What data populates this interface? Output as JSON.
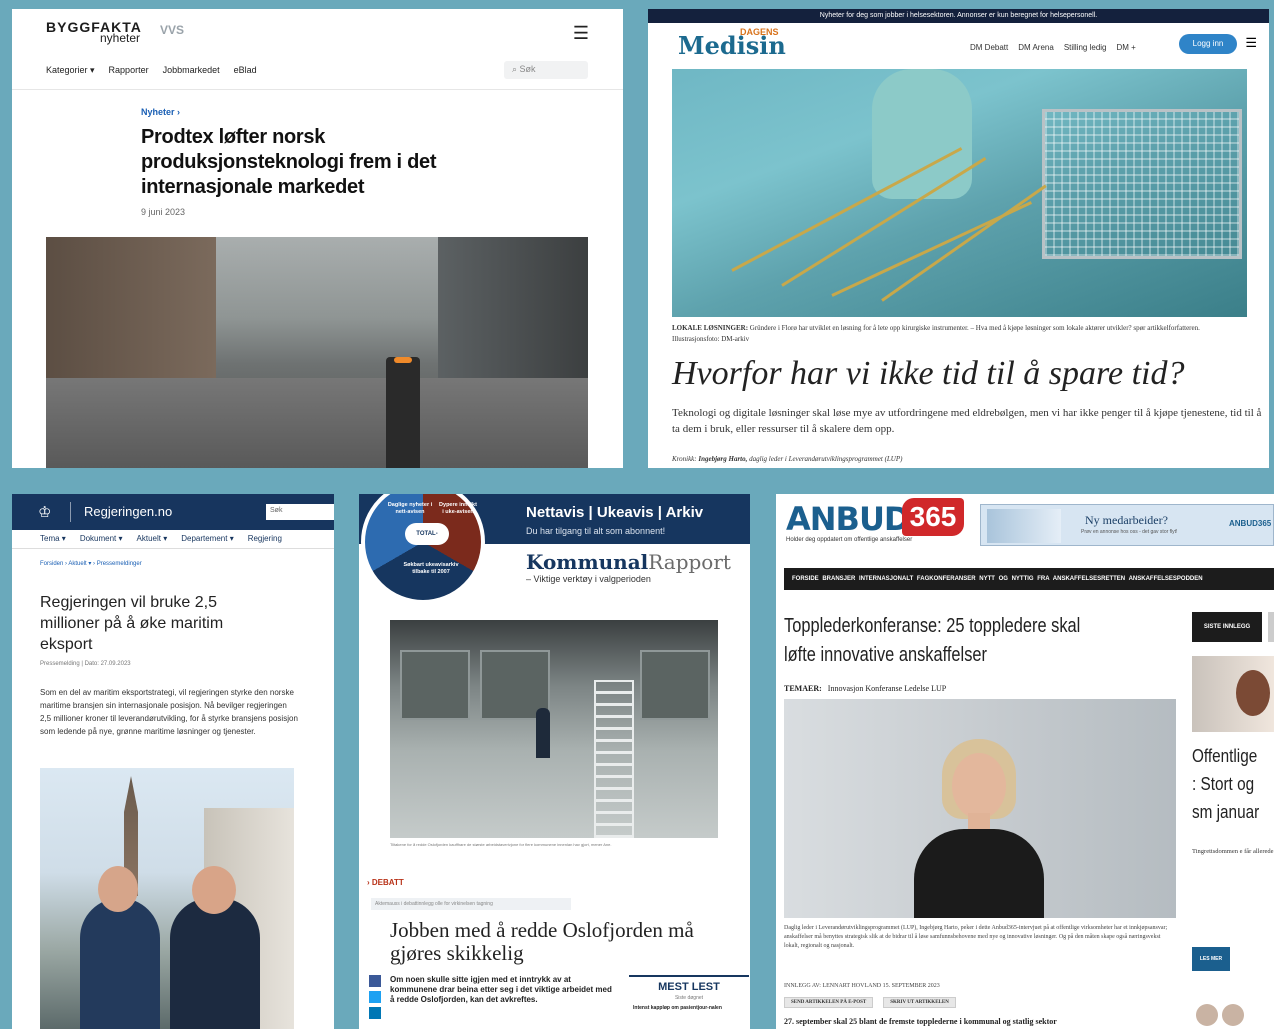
{
  "byggfakta": {
    "logo": "BYGGFAKTA",
    "logo_sub": "nyheter",
    "logo_partner": "VVS",
    "nav": [
      "Kategorier ▾",
      "Rapporter",
      "Jobbmarkedet",
      "eBlad"
    ],
    "search_placeholder": "Søk",
    "kicker": "Nyheter ›",
    "headline": "Prodtex løfter norsk produksjonsteknologi frem i det internasjonale markedet",
    "date": "9 juni 2023"
  },
  "medisin": {
    "topbar": "Nyheter for deg som jobber i helsesektoren. Annonser er kun beregnet for helsepersonell.",
    "logo_small": "DAGENS",
    "logo": "Medisin",
    "nav": [
      "DM Debatt",
      "DM Arena",
      "Stilling ledig",
      "DM +"
    ],
    "login": "Logg inn",
    "caption_label": "LOKALE LØSNINGER:",
    "caption": "Gründere i Florø har utviklet en løsning for å lete opp kirurgiske instrumenter. – Hva med å kjøpe løsninger som lokale aktører utvikler? spør artikkelforfatteren. Illustrasjonsfoto: DM-arkiv",
    "headline": "Hvorfor har vi ikke tid til å spare tid?",
    "lead": "Teknologi og digitale løsninger skal løse mye av utfordringene med eldrebølgen, men vi har ikke penger til å kjøpe tjenestene, tid til å ta dem i bruk, eller ressurser til å skalere dem opp.",
    "byline_label": "Kronikk:",
    "byline_name": "Ingebjørg Harto,",
    "byline_role": "daglig leder i Leverandørutviklingsprogrammet (LUP)"
  },
  "regjeringen": {
    "crest": "♔",
    "site": "Regjeringen.no",
    "search": "Søk",
    "nav": [
      "Tema ▾",
      "Dokument ▾",
      "Aktuelt ▾",
      "Departement ▾",
      "Regjering"
    ],
    "breadcrumb": "Forsiden › Aktuelt ▾ › Pressemeldinger",
    "headline": "Regjeringen vil bruke 2,5 millioner på å øke maritim eksport",
    "meta": "Pressemelding | Dato: 27.09.2023",
    "body": "Som en del av maritim eksportstrategi, vil regjeringen styrke den norske maritime bransjen sin internasjonale posisjon. Nå bevilger regjeringen 2,5 millioner kroner til leverandørutvikling, for å styrke bransjens posisjon som ledende på nye, grønne maritime løsninger og tjenester."
  },
  "kommunal": {
    "pie_t1": "Daglige nyheter i nett-avisen",
    "pie_t2": "Dypere innsikt i uke-avisen",
    "pie_center": "TOTAL-",
    "pie_t3": "Søkbart ukeavisarkiv tilbake til 2007",
    "nav": "Nettavis | Ukeavis | Arkiv",
    "nav_sub": "Du har tilgang til alt som abonnent!",
    "brand_bold": "Kommunal",
    "brand_light": "Rapport",
    "tagline": "– Viktige verktøy i valgperioden",
    "photo_caption": "Tiltakene for å redde Oslofjorden kauffhare de største arbeidstaverivjone for flere kommunene innenlan hav gjort, mener Ane.",
    "section": "› DEBATT",
    "intro": "Aktemauss i debattinnlegg olle for virkinelsen tagning",
    "headline": "Jobben med å redde Oslofjorden må gjøres skikkelig",
    "text": "Om noen skulle sitte igjen med et inntrykk av at kommunene drar beina etter seg i det viktige arbeidet med å redde Oslofjorden, kan det avkreftes.",
    "mest": "MEST LEST",
    "mest_sub": "Siste døgnet",
    "mest_item": "Intenst kappløp om pasientjour-nalen"
  },
  "anbud": {
    "logo": "ANBUD",
    "logo_num": "365",
    "logo_sub": "Holder deg oppdatert om offentlige anskaffelser",
    "ad_title": "Ny medarbeider?",
    "ad_sub": "Prøv en annonse hos oss - det gav stor flyt!",
    "ad_brand": "ANBUD365",
    "nav": "FORSIDE  BRANSJER  INTERNASJONALT  FAGKONFERANSER  NYTT OG NYTTIG FRA ANSKAFFELSESRETTEN  ANSKAFFELSESPODDEN",
    "headline": "Topplederkonferanse: 25 toppledere skal løfte innovative anskaffelser",
    "temaer_label": "TEMAER:",
    "temaer": "Innovasjon   Konferanse   Ledelse   LUP",
    "caption": "Daglig leder i Leverandørutviklingsprogrammet (LUP), Ingebjørg Harto, peker i dette Anbud365-intervjuet på at offentlige virksomheter har et innkjøpsansvar; anskaffelser må benyttes strategisk slik at de bidrar til å løse samfunnsbehovene med nye og innovative løsninger. Og på den måten skape også næringsvekst lokalt, regionalt og nasjonalt.",
    "byline": "INNLEGG AV: LENNART HOVLAND    15. SEPTEMBER 2023",
    "btn_mail": "SEND ARTIKKELEN PÅ E-POST",
    "btn_print": "SKRIV UT ARTIKKELEN",
    "body": "27. september skal 25 blant de fremste topplederne i kommunal og statlig sektor",
    "side_btn": "SISTE INNLEGG",
    "side_headline": "Offentlige : Stort og sm januar",
    "side_text": "Tingrettsdommen e får allerede konsek sykehjem skal konk Arbeidstilsynet får Revmatikerne vil ik",
    "les_mer": "LES MER"
  }
}
